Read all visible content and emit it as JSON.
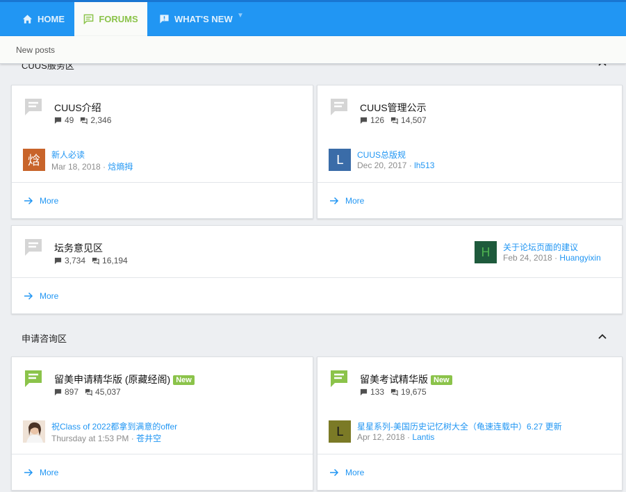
{
  "nav": {
    "home": "HOME",
    "forums": "FORUMS",
    "whats_new": "WHAT'S NEW"
  },
  "subnav": {
    "new_posts": "New posts"
  },
  "colors": {
    "nav_bg": "#2196f3",
    "accent_green": "#8bc34a",
    "link_blue": "#2196f3"
  },
  "sections": [
    {
      "title": "CUUS服务区",
      "collapse_icon": "chevron-up-icon",
      "forums": [
        {
          "title": "CUUS介绍",
          "threads": "49",
          "messages": "2,346",
          "latest": {
            "avatar_text": "焓",
            "avatar_color": "#c8642a",
            "title": "新人必读",
            "date": "Mar 18, 2018",
            "user": "焓熵拇"
          },
          "more": "More"
        },
        {
          "title": "CUUS管理公示",
          "threads": "126",
          "messages": "14,507",
          "latest": {
            "avatar_text": "L",
            "avatar_color": "#3a6ca8",
            "title": "CUUS总版规",
            "date": "Dec 20, 2017",
            "user": "lh513"
          },
          "more": "More"
        },
        {
          "title": "坛务意见区",
          "threads": "3,734",
          "messages": "16,194",
          "latest": {
            "avatar_text": "H",
            "avatar_color": "#1e5a3c",
            "title": "关于论坛页面的建议",
            "date": "Feb 24, 2018",
            "user": "Huangyixin"
          },
          "more": "More"
        }
      ]
    },
    {
      "title": "申请咨询区",
      "collapse_icon": "chevron-up-icon",
      "forums": [
        {
          "title": "留美申请精华版 (原藏经阁)",
          "badge": "New",
          "threads": "897",
          "messages": "45,037",
          "latest": {
            "avatar_text": "",
            "title": "祝Class of 2022都拿到满意的offer",
            "date": "Thursday at 1:53 PM",
            "user": "苍井空"
          },
          "more": "More"
        },
        {
          "title": "留美考试精华版",
          "badge": "New",
          "threads": "133",
          "messages": "19,675",
          "latest": {
            "avatar_text": "L",
            "avatar_color": "#7b7a26",
            "title": "星星系列-美国历史记忆树大全（龟速连载中）6.27 更新",
            "date": "Apr 12, 2018",
            "user": "Lantis"
          },
          "more": "More"
        }
      ]
    }
  ]
}
